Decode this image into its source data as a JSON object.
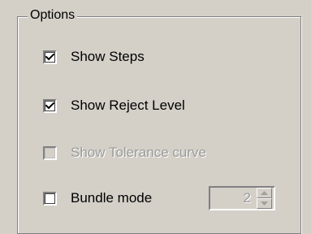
{
  "group": {
    "title": "Options"
  },
  "options": [
    {
      "label": "Show Steps",
      "checked": true,
      "enabled": true
    },
    {
      "label": "Show Reject Level",
      "checked": true,
      "enabled": true
    },
    {
      "label": "Show Tolerance curve",
      "checked": false,
      "enabled": false
    },
    {
      "label": "Bundle mode",
      "checked": false,
      "enabled": true
    }
  ],
  "bundle_count": {
    "value": "2",
    "enabled": false
  },
  "icons": {
    "check": "checkmark-icon",
    "up": "spin-up-arrow-icon",
    "down": "spin-down-arrow-icon"
  }
}
